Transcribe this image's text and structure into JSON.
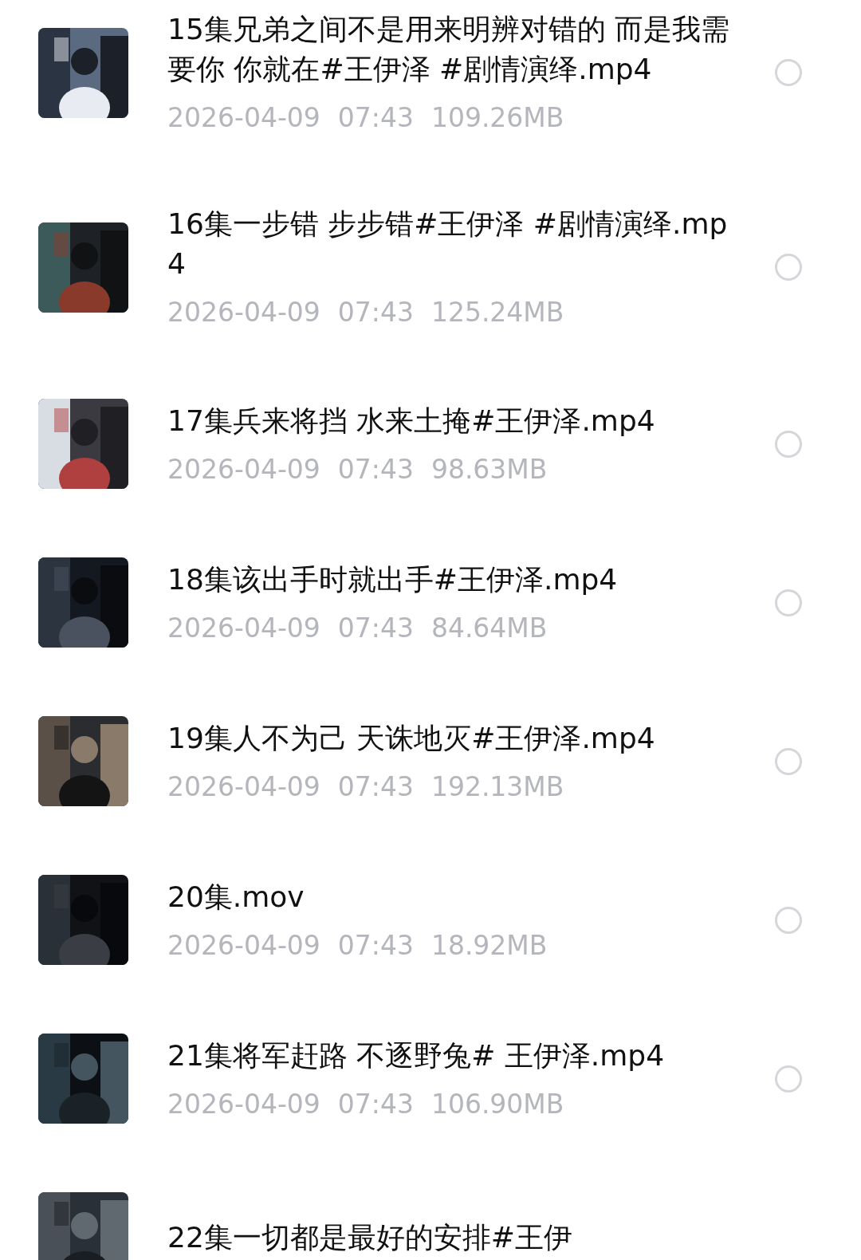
{
  "files": [
    {
      "title": "15集兄弟之间不是用来明辨对错的 而是我需要你 你就在#王伊泽 #剧情演绎.mp4",
      "date": "2026-04-09",
      "time": "07:43",
      "size": "109.26MB",
      "selected": false
    },
    {
      "title": "16集一步错 步步错#王伊泽 #剧情演绎.mp4",
      "date": "2026-04-09",
      "time": "07:43",
      "size": "125.24MB",
      "selected": false
    },
    {
      "title": "17集兵来将挡 水来土掩#王伊泽.mp4",
      "date": "2026-04-09",
      "time": "07:43",
      "size": "98.63MB",
      "selected": false
    },
    {
      "title": "18集该出手时就出手#王伊泽.mp4",
      "date": "2026-04-09",
      "time": "07:43",
      "size": "84.64MB",
      "selected": false
    },
    {
      "title": "19集人不为己 天诛地灭#王伊泽.mp4",
      "date": "2026-04-09",
      "time": "07:43",
      "size": "192.13MB",
      "selected": false
    },
    {
      "title": "20集.mov",
      "date": "2026-04-09",
      "time": "07:43",
      "size": "18.92MB",
      "selected": false
    },
    {
      "title": "21集将军赶路 不逐野兔# 王伊泽.mp4",
      "date": "2026-04-09",
      "time": "07:43",
      "size": "106.90MB",
      "selected": false
    },
    {
      "title": "22集一切都是最好的安排#王伊"
    }
  ]
}
